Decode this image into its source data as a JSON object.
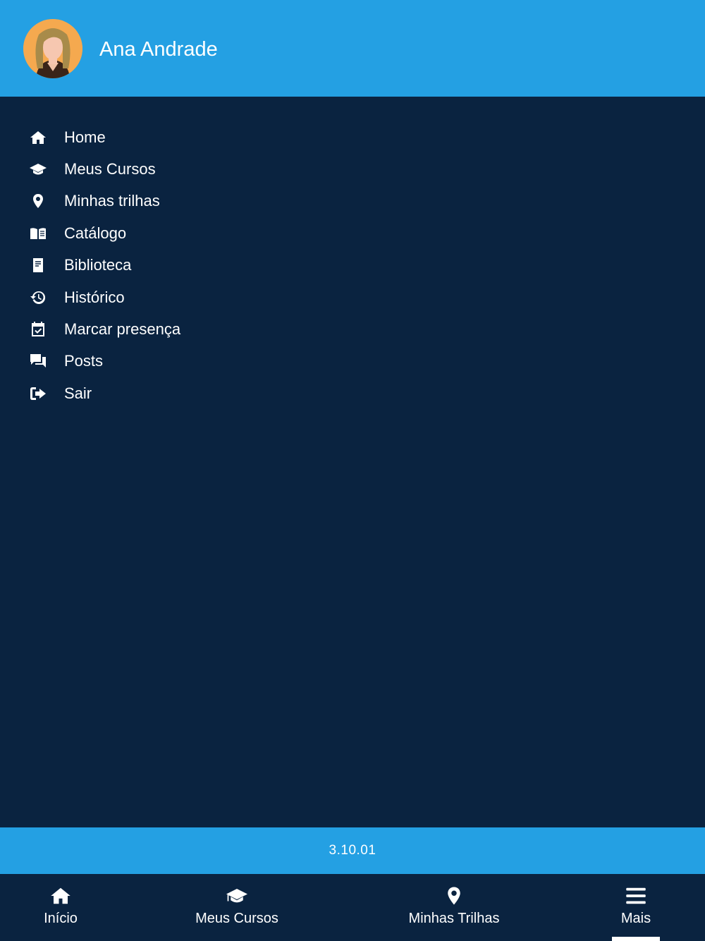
{
  "colors": {
    "primary": "#24a0e3",
    "background": "#0a2340",
    "text": "#ffffff",
    "avatar_bg": "#f5a94f"
  },
  "header": {
    "user_name": "Ana Andrade",
    "avatar_icon": "avatar-female"
  },
  "menu": {
    "items": [
      {
        "label": "Home",
        "icon": "home-icon"
      },
      {
        "label": "Meus Cursos",
        "icon": "graduation-cap-icon"
      },
      {
        "label": "Minhas trilhas",
        "icon": "map-pin-icon"
      },
      {
        "label": "Catálogo",
        "icon": "open-book-icon"
      },
      {
        "label": "Biblioteca",
        "icon": "book-icon"
      },
      {
        "label": "Histórico",
        "icon": "history-icon"
      },
      {
        "label": "Marcar presença",
        "icon": "calendar-check-icon"
      },
      {
        "label": "Posts",
        "icon": "chat-icon"
      },
      {
        "label": "Sair",
        "icon": "sign-out-icon"
      }
    ]
  },
  "footer": {
    "version": "3.10.01"
  },
  "tabbar": {
    "tabs": [
      {
        "label": "Início",
        "icon": "home-icon"
      },
      {
        "label": "Meus Cursos",
        "icon": "graduation-cap-icon"
      },
      {
        "label": "Minhas Trilhas",
        "icon": "map-pin-icon"
      },
      {
        "label": "Mais",
        "icon": "menu-icon",
        "active": true
      }
    ]
  }
}
